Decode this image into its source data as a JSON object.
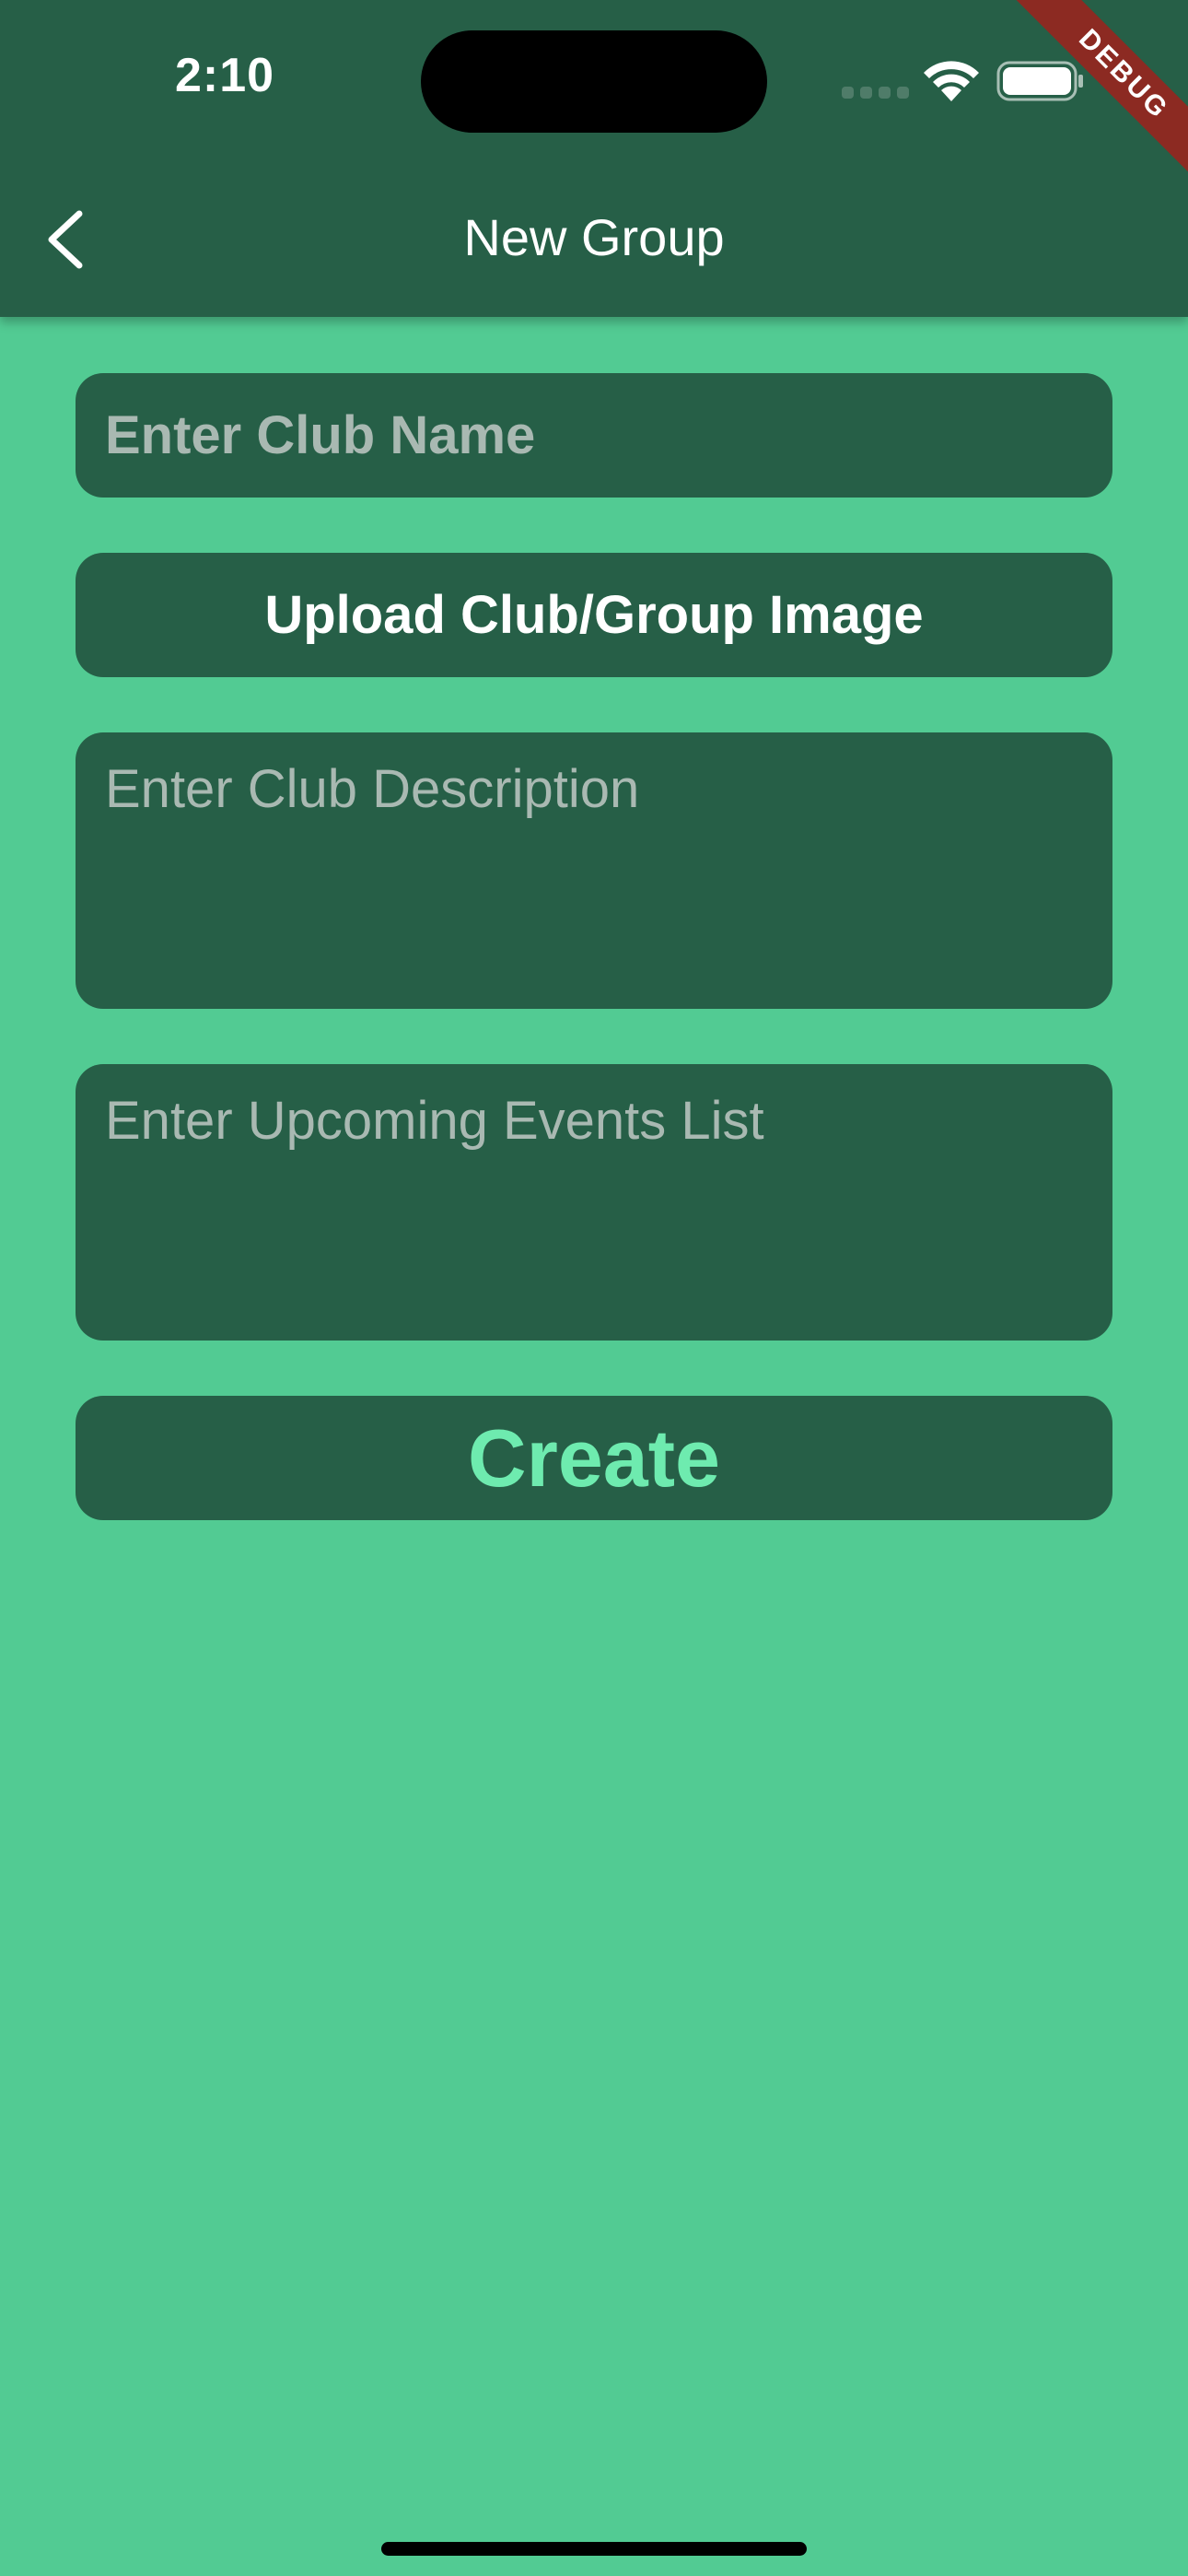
{
  "status_bar": {
    "time": "2:10"
  },
  "debug_banner": {
    "label": "DEBUG"
  },
  "header": {
    "title": "New Group",
    "back_icon": "chevron-left-icon"
  },
  "form": {
    "club_name": {
      "placeholder": "Enter Club Name",
      "value": ""
    },
    "upload_button": {
      "label": "Upload Club/Group Image"
    },
    "description": {
      "placeholder": "Enter Club Description",
      "value": ""
    },
    "events": {
      "placeholder": "Enter Upcoming Events List",
      "value": ""
    },
    "create_button": {
      "label": "Create"
    }
  },
  "colors": {
    "background": "#52CB93",
    "surface": "#265F47",
    "accent": "#6EEBAF",
    "placeholder": "#A9B9B2",
    "debug": "#8C2A22"
  }
}
